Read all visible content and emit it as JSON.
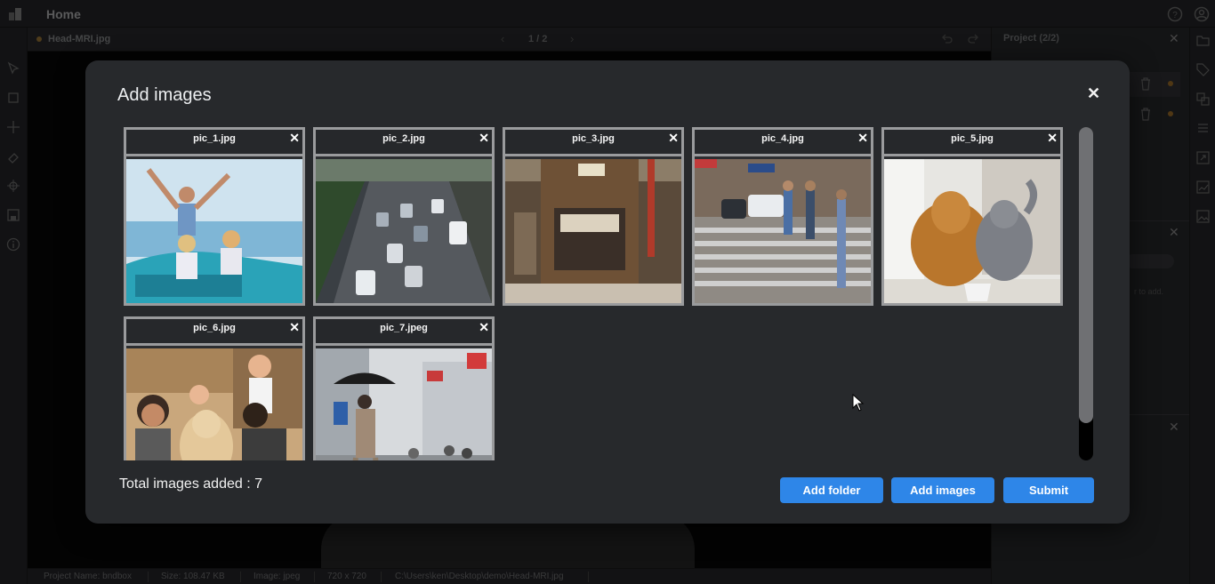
{
  "topbar": {
    "title": "Home",
    "icons": [
      "app-logo-icon",
      "help-icon",
      "user-icon"
    ]
  },
  "tab": {
    "filename": "Head-MRI.jpg",
    "pager": "1 / 2"
  },
  "statusbar": {
    "project_name": "Project Name: bndbox",
    "size": "Size: 108.47 KB",
    "image_type": "Image: jpeg",
    "dimensions": "720 x 720",
    "path": "C:\\Users\\ken\\Desktop\\demo\\Head-MRI.jpg"
  },
  "right_panel": {
    "title": "Project (2/2)",
    "hint": "r to add."
  },
  "modal": {
    "title": "Add images",
    "close_glyph": "✕",
    "cards": [
      {
        "name": "pic_1.jpg",
        "remove": "✕"
      },
      {
        "name": "pic_2.jpg",
        "remove": "✕"
      },
      {
        "name": "pic_3.jpg",
        "remove": "✕"
      },
      {
        "name": "pic_4.jpg",
        "remove": "✕"
      },
      {
        "name": "pic_5.jpg",
        "remove": "✕"
      },
      {
        "name": "pic_6.jpg",
        "remove": "✕"
      },
      {
        "name": "pic_7.jpeg",
        "remove": "✕"
      }
    ],
    "total_label": "Total images added : 7",
    "buttons": {
      "add_folder": "Add folder",
      "add_images": "Add images",
      "submit": "Submit"
    }
  },
  "colors": {
    "accent": "#2e86e8",
    "modal_bg": "#27292c",
    "card_border": "#9a9b9d"
  }
}
